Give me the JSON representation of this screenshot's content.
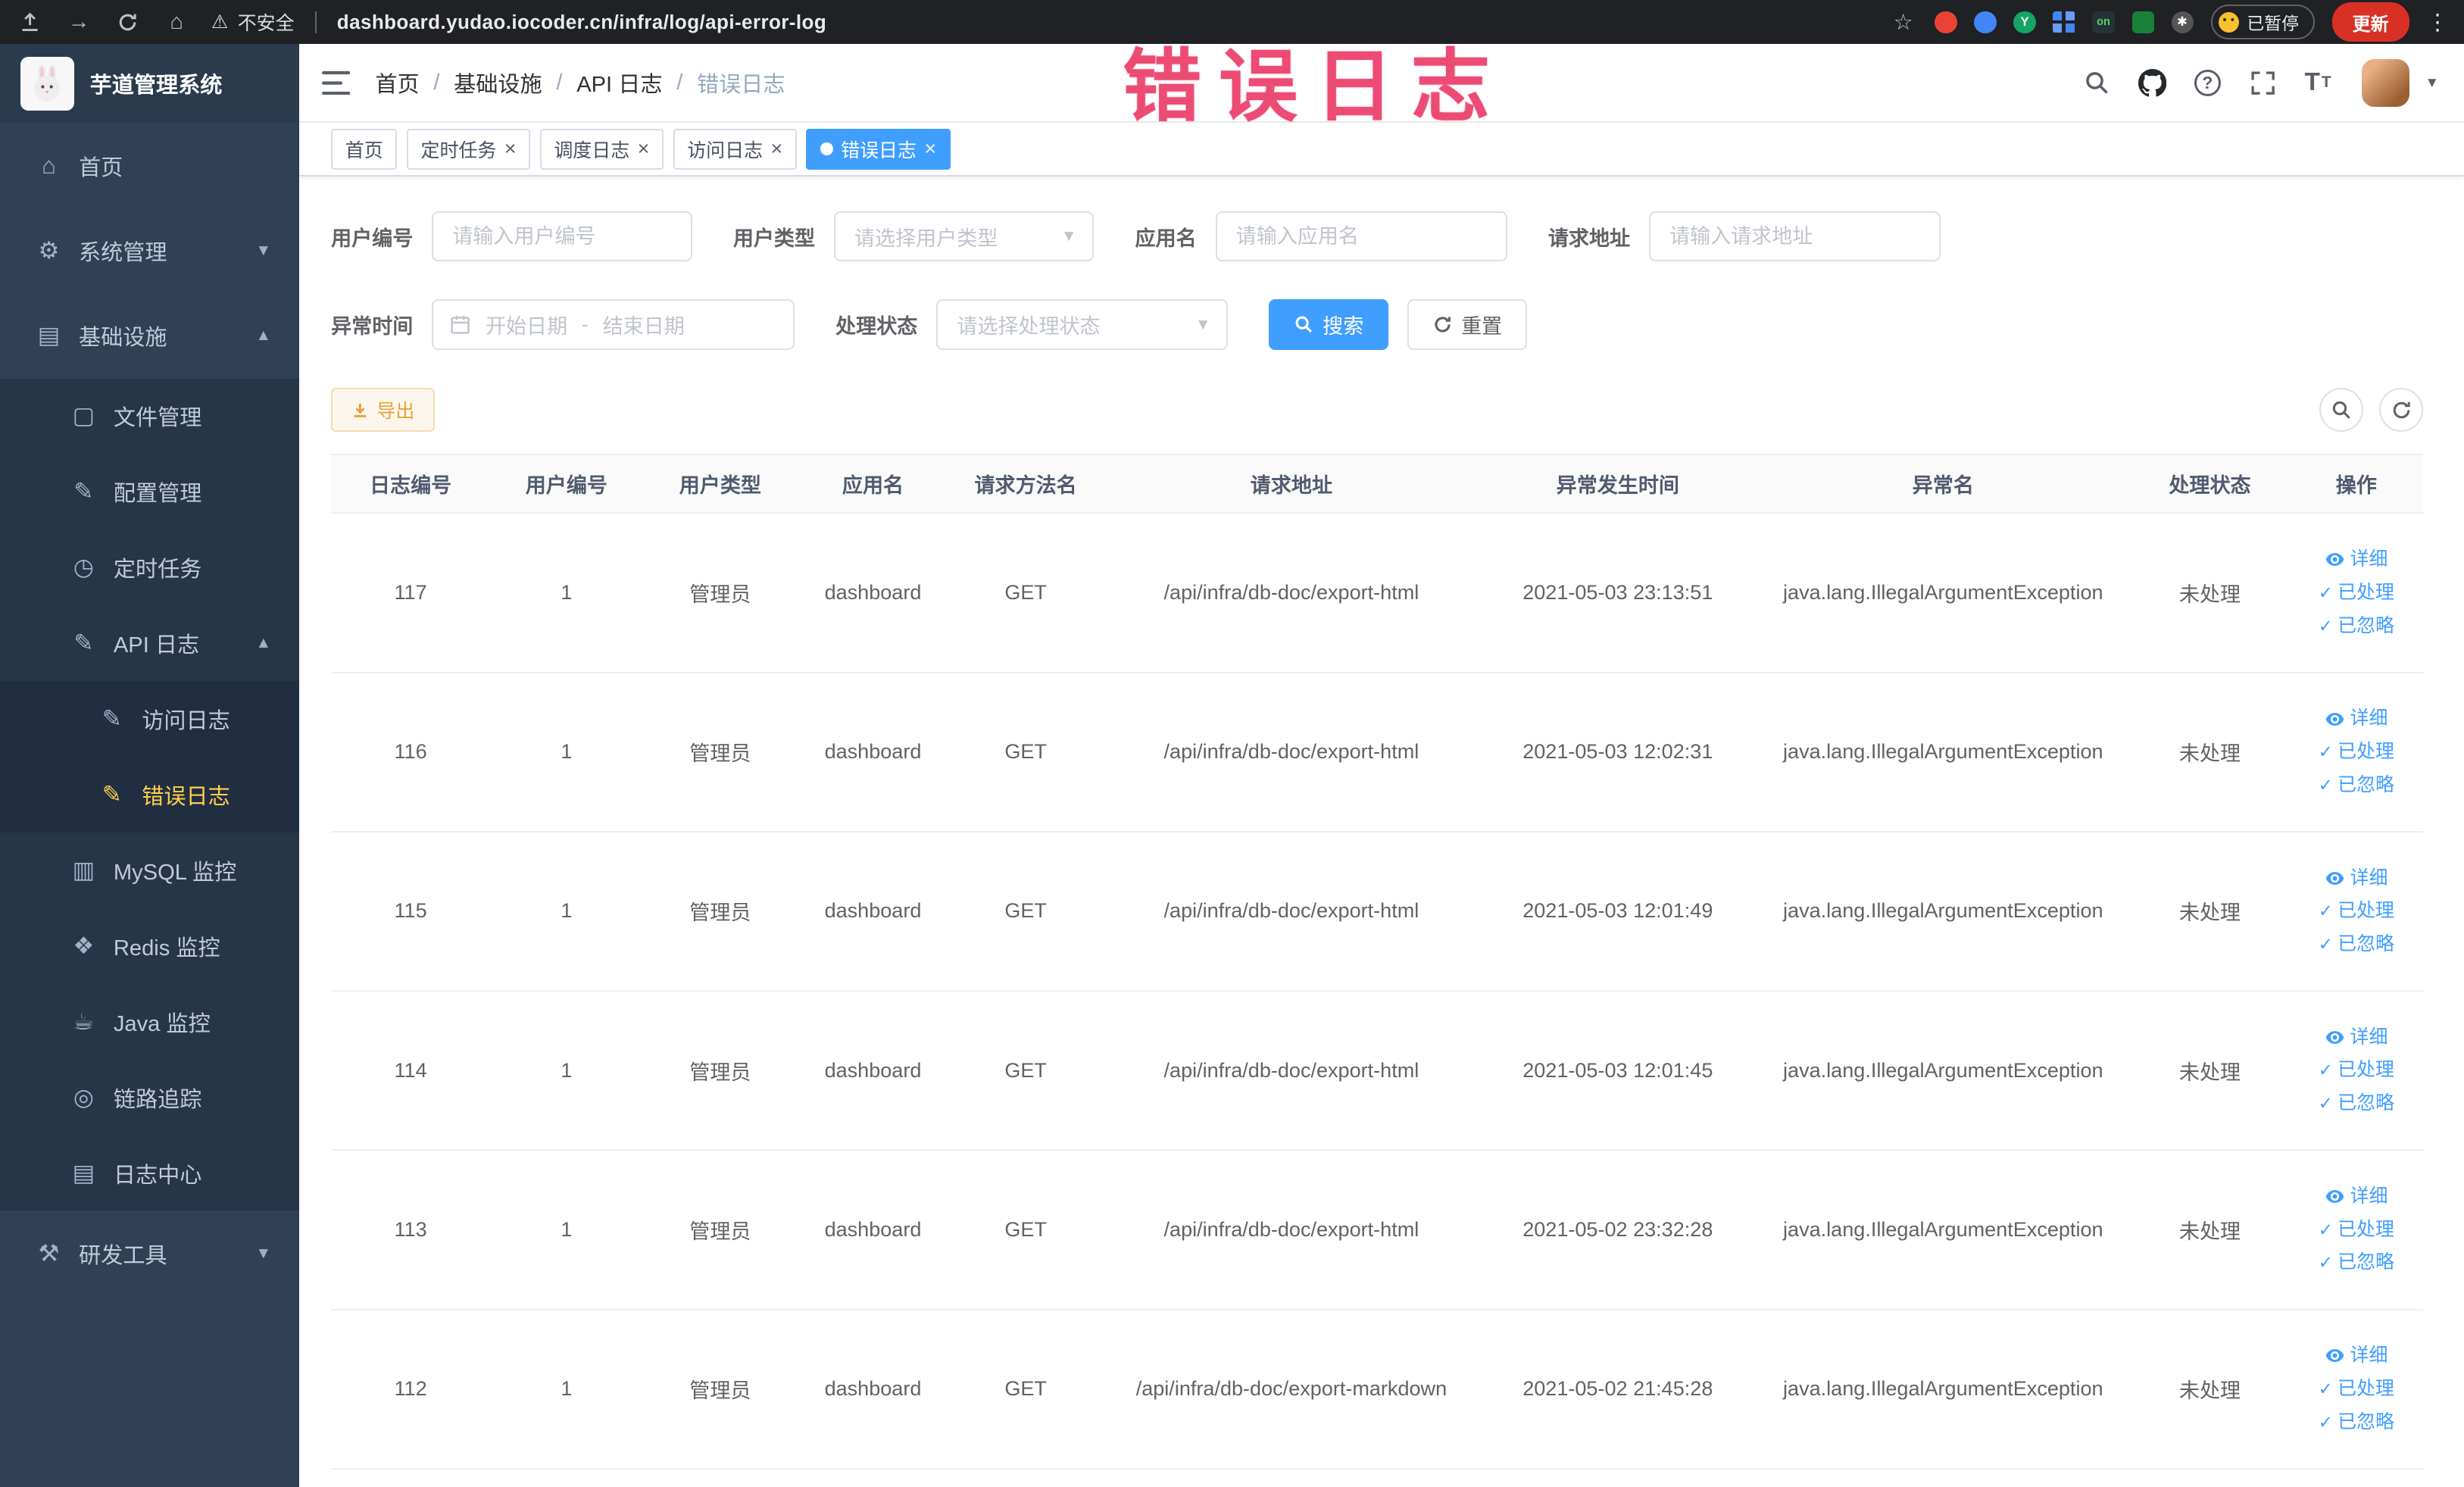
{
  "browser": {
    "security_label": "不安全",
    "url": "dashboard.yudao.iocoder.cn/infra/log/api-error-log",
    "paused_badge": "已暂停",
    "update_button": "更新"
  },
  "annotation": {
    "watermark": "错误日志",
    "color": "#ec4b74"
  },
  "sidebar": {
    "logo_title": "芋道管理系统",
    "menu": [
      {
        "label": "首页",
        "icon": "home-icon",
        "glyph": "⌂",
        "level": 1
      },
      {
        "label": "系统管理",
        "icon": "gear-icon",
        "glyph": "⚙",
        "level": 1,
        "arrow": "down"
      },
      {
        "label": "基础设施",
        "icon": "infrastructure-icon",
        "glyph": "▤",
        "level": 1,
        "arrow": "up"
      },
      {
        "label": "文件管理",
        "icon": "file-icon",
        "glyph": "▢",
        "level": 2
      },
      {
        "label": "配置管理",
        "icon": "config-icon",
        "glyph": "✎",
        "level": 2
      },
      {
        "label": "定时任务",
        "icon": "timer-icon",
        "glyph": "◷",
        "level": 2
      },
      {
        "label": "API 日志",
        "icon": "api-log-icon",
        "glyph": "✎",
        "level": 2,
        "arrow": "up"
      },
      {
        "label": "访问日志",
        "icon": "access-log-icon",
        "glyph": "✎",
        "level": 3
      },
      {
        "label": "错误日志",
        "icon": "error-log-icon",
        "glyph": "✎",
        "level": 3,
        "active": true
      },
      {
        "label": "MySQL 监控",
        "icon": "mysql-monitor-icon",
        "glyph": "▥",
        "level": 2
      },
      {
        "label": "Redis 监控",
        "icon": "redis-monitor-icon",
        "glyph": "❖",
        "level": 2
      },
      {
        "label": "Java 监控",
        "icon": "java-monitor-icon",
        "glyph": "☕",
        "level": 2
      },
      {
        "label": "链路追踪",
        "icon": "trace-icon",
        "glyph": "◎",
        "level": 2
      },
      {
        "label": "日志中心",
        "icon": "log-center-icon",
        "glyph": "▤",
        "level": 2
      },
      {
        "label": "研发工具",
        "icon": "dev-tools-icon",
        "glyph": "⚒",
        "level": 1,
        "arrow": "down"
      }
    ]
  },
  "header": {
    "breadcrumb": [
      "首页",
      "基础设施",
      "API 日志",
      "错误日志"
    ]
  },
  "tabs": [
    {
      "label": "首页",
      "closable": false,
      "active": false
    },
    {
      "label": "定时任务",
      "closable": true,
      "active": false
    },
    {
      "label": "调度日志",
      "closable": true,
      "active": false
    },
    {
      "label": "访问日志",
      "closable": true,
      "active": false
    },
    {
      "label": "错误日志",
      "closable": true,
      "active": true
    }
  ],
  "filters": {
    "user_id": {
      "label": "用户编号",
      "placeholder": "请输入用户编号"
    },
    "user_type": {
      "label": "用户类型",
      "placeholder": "请选择用户类型"
    },
    "app_name": {
      "label": "应用名",
      "placeholder": "请输入应用名"
    },
    "request_url": {
      "label": "请求地址",
      "placeholder": "请输入请求地址"
    },
    "exception_time": {
      "label": "异常时间",
      "start_placeholder": "开始日期",
      "separator": "-",
      "end_placeholder": "结束日期"
    },
    "process_status": {
      "label": "处理状态",
      "placeholder": "请选择处理状态"
    },
    "search_button": "搜索",
    "reset_button": "重置"
  },
  "toolbar": {
    "export_button": "导出"
  },
  "table": {
    "columns": [
      "日志编号",
      "用户编号",
      "用户类型",
      "应用名",
      "请求方法名",
      "请求地址",
      "异常发生时间",
      "异常名",
      "处理状态",
      "操作"
    ],
    "actions": [
      "详细",
      "已处理",
      "已忽略"
    ],
    "rows": [
      {
        "id": "117",
        "user_id": "1",
        "user_type": "管理员",
        "app": "dashboard",
        "method": "GET",
        "url": "/api/infra/db-doc/export-html",
        "time": "2021-05-03 23:13:51",
        "exception": "java.lang.IllegalArgumentException",
        "status": "未处理"
      },
      {
        "id": "116",
        "user_id": "1",
        "user_type": "管理员",
        "app": "dashboard",
        "method": "GET",
        "url": "/api/infra/db-doc/export-html",
        "time": "2021-05-03 12:02:31",
        "exception": "java.lang.IllegalArgumentException",
        "status": "未处理"
      },
      {
        "id": "115",
        "user_id": "1",
        "user_type": "管理员",
        "app": "dashboard",
        "method": "GET",
        "url": "/api/infra/db-doc/export-html",
        "time": "2021-05-03 12:01:49",
        "exception": "java.lang.IllegalArgumentException",
        "status": "未处理"
      },
      {
        "id": "114",
        "user_id": "1",
        "user_type": "管理员",
        "app": "dashboard",
        "method": "GET",
        "url": "/api/infra/db-doc/export-html",
        "time": "2021-05-03 12:01:45",
        "exception": "java.lang.IllegalArgumentException",
        "status": "未处理"
      },
      {
        "id": "113",
        "user_id": "1",
        "user_type": "管理员",
        "app": "dashboard",
        "method": "GET",
        "url": "/api/infra/db-doc/export-html",
        "time": "2021-05-02 23:32:28",
        "exception": "java.lang.IllegalArgumentException",
        "status": "未处理"
      },
      {
        "id": "112",
        "user_id": "1",
        "user_type": "管理员",
        "app": "dashboard",
        "method": "GET",
        "url": "/api/infra/db-doc/export-markdown",
        "time": "2021-05-02 21:45:28",
        "exception": "java.lang.IllegalArgumentException",
        "status": "未处理"
      }
    ]
  }
}
